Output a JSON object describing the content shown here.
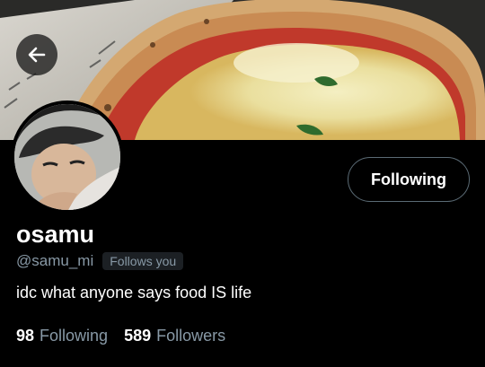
{
  "profile": {
    "name": "osamu",
    "handle": "@samu_mi",
    "follows_you": "Follows you",
    "bio": "idc what anyone says food IS life",
    "follow_button": "Following"
  },
  "stats": [
    {
      "count": "98",
      "label": "Following"
    },
    {
      "count": "589",
      "label": "Followers"
    }
  ],
  "icons": {
    "back": "arrow-left-icon"
  },
  "colors": {
    "background": "#000000",
    "secondary_text": "#8899a6",
    "button_border": "#5b6b75"
  }
}
